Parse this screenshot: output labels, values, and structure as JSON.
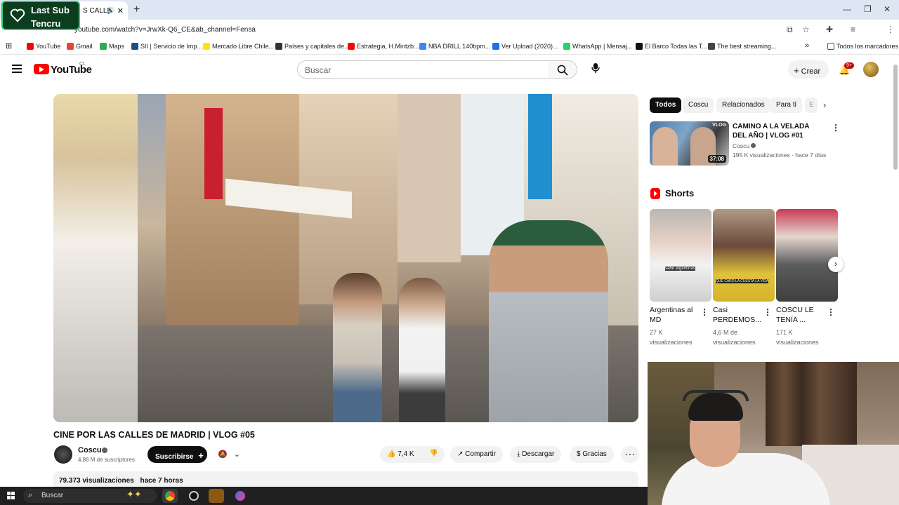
{
  "overlay": {
    "line1": "Last Sub",
    "line2": "Tencru"
  },
  "browser": {
    "tab_title": "S CALLE",
    "new_tab": "+",
    "url": "youtube.com/watch?v=JrwXk-Q6_CE&ab_channel=Fensa",
    "bookmarks": [
      {
        "label": "YouTube",
        "color": "#ff0000"
      },
      {
        "label": "Gmail",
        "color": "#ea4335"
      },
      {
        "label": "Maps",
        "color": "#34a853"
      },
      {
        "label": "SII | Servicio de Imp...",
        "color": "#1a4f8a"
      },
      {
        "label": "Mercado Libre Chile...",
        "color": "#ffe600"
      },
      {
        "label": "Países y capitales de...",
        "color": "#333333"
      },
      {
        "label": "Estrategia, H.Mintzb...",
        "color": "#ff0000"
      },
      {
        "label": "NBA DRILL 140bpm...",
        "color": "#4285f4"
      },
      {
        "label": "Ver Upload (2020)...",
        "color": "#1a73e8"
      },
      {
        "label": "WhatsApp | Mensaj...",
        "color": "#25d366"
      },
      {
        "label": "El Barco Todas las T...",
        "color": "#111111"
      },
      {
        "label": "The best streaming...",
        "color": "#444444"
      }
    ],
    "all_bookmarks": "Todos los marcadores"
  },
  "youtube": {
    "logo_text": "YouTube",
    "region": "CL",
    "search_placeholder": "Buscar",
    "create_label": "Crear",
    "notif_badge": "9+",
    "video": {
      "title": "CINE POR LAS CALLES DE MADRID | VLOG #05",
      "channel": "Coscu",
      "subscribers": "4,86 M de suscriptores",
      "subscribe_label": "Suscribirse",
      "likes": "7,4 K",
      "share_label": "Compartir",
      "download_label": "Descargar",
      "thanks_label": "Gracias",
      "views": "79.373 visualizaciones",
      "age": "hace 7 horas"
    },
    "chips": [
      "Todos",
      "Coscu",
      "Relacionados",
      "Para ti",
      "E"
    ],
    "recommended": {
      "title": "CAMINO A LA VELADA DEL AÑO | VLOG #01",
      "channel": "Coscu",
      "meta": "195 K visualizaciones · hace 7 días",
      "duration": "37:08",
      "badge": "VLOG"
    },
    "shorts_label": "Shorts",
    "shorts": [
      {
        "title": "Argentinas al MD",
        "views": "27 K",
        "views_label": "visualizaciones",
        "caption": "sabe argentinas"
      },
      {
        "title": "Casi PERDEMOS...",
        "views": "4,6 M de",
        "views_label": "visualizaciones",
        "caption": "QUE CARO LA CUESTA LA VIDA"
      },
      {
        "title": "COSCU LE TENÍA ...",
        "views": "171 K",
        "views_label": "visualizaciones",
        "caption": ""
      }
    ]
  },
  "taskbar": {
    "search": "Buscar"
  },
  "colors": {
    "yt_red": "#ff0000",
    "subscribe_bg": "#0f0f0f",
    "overlay_green": "#2ecc71"
  }
}
